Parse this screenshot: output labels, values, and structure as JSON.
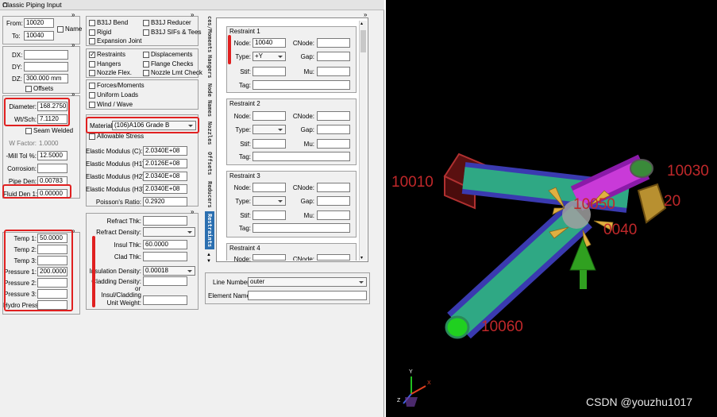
{
  "window": {
    "title": "Classic Piping Input",
    "pin_glyph": "⊓",
    "expand_glyph": "»"
  },
  "elem": {
    "from_label": "From:",
    "from_value": "10020",
    "to_label": "To:",
    "to_value": "10040",
    "name_label": "Name"
  },
  "deltas": {
    "dx_label": "DX:",
    "dx_value": "",
    "dy_label": "DY:",
    "dy_value": "",
    "dz_label": "DZ:",
    "dz_value": "300.000 mm",
    "offsets_label": "Offsets"
  },
  "pipe": {
    "diameter_label": "Diameter:",
    "diameter_value": "168.2750",
    "wt_label": "Wt/Sch:",
    "wt_value": "7.1120",
    "seam_label": "Seam Welded",
    "wfactor_label": "W Factor:",
    "wfactor_value": "1.0000",
    "milltol_label": "-Mill Tol %:",
    "milltol_value": "12.5000",
    "corrosion_label": "Corrosion:",
    "corrosion_value": "",
    "pipeden_label": "Pipe Den:",
    "pipeden_value": "0.00783",
    "fluidden_label": "Fluid Den 1:",
    "fluidden_value": "0.00000"
  },
  "loads": {
    "temp1_label": "Temp 1:",
    "temp1_value": "50.0000",
    "temp2_label": "Temp 2:",
    "temp2_value": "",
    "temp3_label": "Temp 3:",
    "temp3_value": "",
    "press1_label": "Pressure 1:",
    "press1_value": "200.0000",
    "press2_label": "Pressure 2:",
    "press2_value": "",
    "press3_label": "Pressure 3:",
    "press3_value": "",
    "hydro_label": "Hydro Press:",
    "hydro_value": ""
  },
  "checks1": {
    "b31j_bend": "B31J Bend",
    "b31j_reducer": "B31J Reducer",
    "rigid": "Rigid",
    "b31j_sifs": "B31J SIFs & Tees",
    "expansion": "Expansion Joint"
  },
  "checks2": {
    "restraints": "Restraints",
    "displacements": "Displacements",
    "hangers": "Hangers",
    "flange_checks": "Flange Checks",
    "nozzle_flex": "Nozzle Flex.",
    "nozzle_lmt": "Nozzle Lmt Check"
  },
  "checks3": {
    "forces": "Forces/Moments",
    "uniform": "Uniform Loads",
    "wind": "Wind / Wave"
  },
  "material": {
    "label": "Material:",
    "value": "(106)A106 Grade B",
    "allowable": "Allowable Stress"
  },
  "modulus": {
    "ec_label": "Elastic Modulus (C):",
    "ec_value": "2.0340E+08",
    "eh1_label": "Elastic Modulus (H1):",
    "eh1_value": "2.0126E+08",
    "eh2_label": "Elastic Modulus (H2):",
    "eh2_value": "2.0340E+08",
    "eh3_label": "Elastic Modulus (H3):",
    "eh3_value": "2.0340E+08",
    "poisson_label": "Poisson's Ratio:",
    "poisson_value": "0.2920"
  },
  "refract": {
    "thk_label": "Refract Thk:",
    "thk_value": "",
    "den_label": "Refract Density:",
    "den_value": ""
  },
  "insul": {
    "thk_label": "Insul Thk:",
    "thk_value": "60.0000",
    "clad_label": "Clad Thk:",
    "clad_value": "",
    "den_label": "Insulation Density:",
    "den_value": "0.00018",
    "claddens_label": "Cladding Density:",
    "claddens_value": "",
    "or_label": "or",
    "unitw_label1": "Insul/Cladding",
    "unitw_label2": "Unit Weight:",
    "unitw_value": ""
  },
  "tabs": [
    "ces/Moments",
    "Hangers",
    "Node Names",
    "Nozzles",
    "Offsets",
    "Reducers",
    "Restraints"
  ],
  "restraints": [
    {
      "title": "Restraint 1",
      "node": "10040",
      "cnode": "",
      "type": "+Y",
      "gap": "",
      "stif": "",
      "mu": "",
      "tag": ""
    },
    {
      "title": "Restraint 2",
      "node": "",
      "cnode": "",
      "type": "",
      "gap": "",
      "stif": "",
      "mu": "",
      "tag": ""
    },
    {
      "title": "Restraint 3",
      "node": "",
      "cnode": "",
      "type": "",
      "gap": "",
      "stif": "",
      "mu": "",
      "tag": ""
    },
    {
      "title": "Restraint 4",
      "node": "",
      "cnode": "",
      "type": "",
      "gap": "",
      "stif": "",
      "mu": "",
      "tag": ""
    }
  ],
  "restraint_labels": {
    "node": "Node:",
    "cnode": "CNode:",
    "type": "Type:",
    "gap": "Gap:",
    "stif": "Stif:",
    "mu": "Mu:",
    "tag": "Tag:"
  },
  "line": {
    "number_label": "Line Number :",
    "number_value": "outer",
    "element_label": "Element Name :",
    "element_value": ""
  },
  "viewport": {
    "node_10010": "10010",
    "node_10030": "10030",
    "node_20": "20",
    "node_10050": "10050",
    "node_0040": "0040",
    "node_10060": "10060",
    "axis_y": "Y",
    "axis_z": "Z",
    "axis_x": "X"
  },
  "watermark": "CSDN @youzhu1017",
  "colors": {
    "pipe": "#2fa884",
    "insulation": "#4040c0",
    "highlight": "#e02020",
    "tab_active": "#2b6fb0",
    "node_label": "#c0282a"
  }
}
